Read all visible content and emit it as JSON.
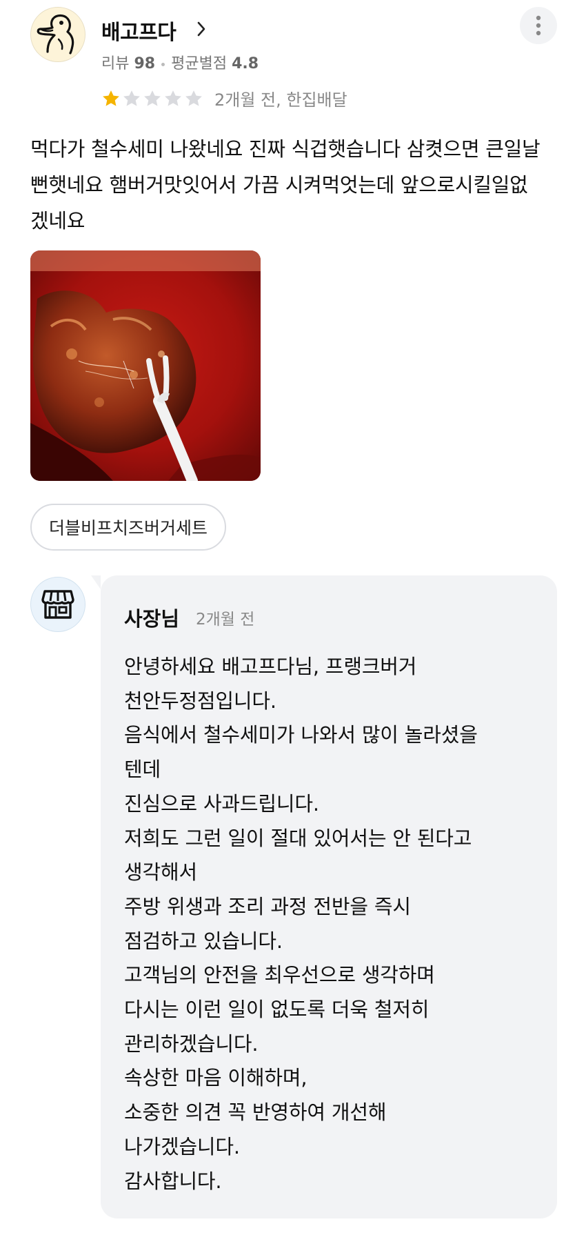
{
  "review": {
    "author": {
      "name": "배고프다",
      "avatar_icon": "duck-avatar-icon",
      "review_count_label": "리뷰",
      "review_count": "98",
      "avg_rating_label": "평균별점",
      "avg_rating": "4.8"
    },
    "more_icon": "more-vertical-icon",
    "rating": {
      "filled": 1,
      "total": 5
    },
    "meta": "2개월 전, 한집배달",
    "text": "먹다가 철수세미 나왔네요 진짜 식겁햇습니다 삼켯으면 큰일날뻔햇네요 햄버거맛잇어서 가끔 시켜먹엇는데 앞으로시킬일없겠네요",
    "menu_tag": "더블비프치즈버거세트"
  },
  "reply": {
    "avatar_icon": "store-icon",
    "author": "사장님",
    "time": "2개월 전",
    "lines": [
      "안녕하세요 배고프다님, 프랭크버거",
      "천안두정점입니다.",
      "음식에서 철수세미가 나와서 많이 놀라셨을",
      "텐데",
      "진심으로 사과드립니다.",
      "저희도 그런 일이 절대 있어서는 안 된다고",
      "생각해서",
      "주방 위생과 조리 과정 전반을 즉시",
      "점검하고 있습니다.",
      "고객님의 안전을 최우선으로 생각하며",
      "다시는 이런 일이 없도록 더욱 철저히",
      "관리하겠습니다.",
      "속상한 마음 이해하며,",
      "소중한 의견 꼭 반영하여 개선해",
      "나가겠습니다.",
      "감사합니다."
    ]
  },
  "colors": {
    "star_filled": "#F5B400",
    "star_empty": "#D9DADE",
    "reply_bg": "#F2F3F5",
    "muted_text": "#888888"
  }
}
